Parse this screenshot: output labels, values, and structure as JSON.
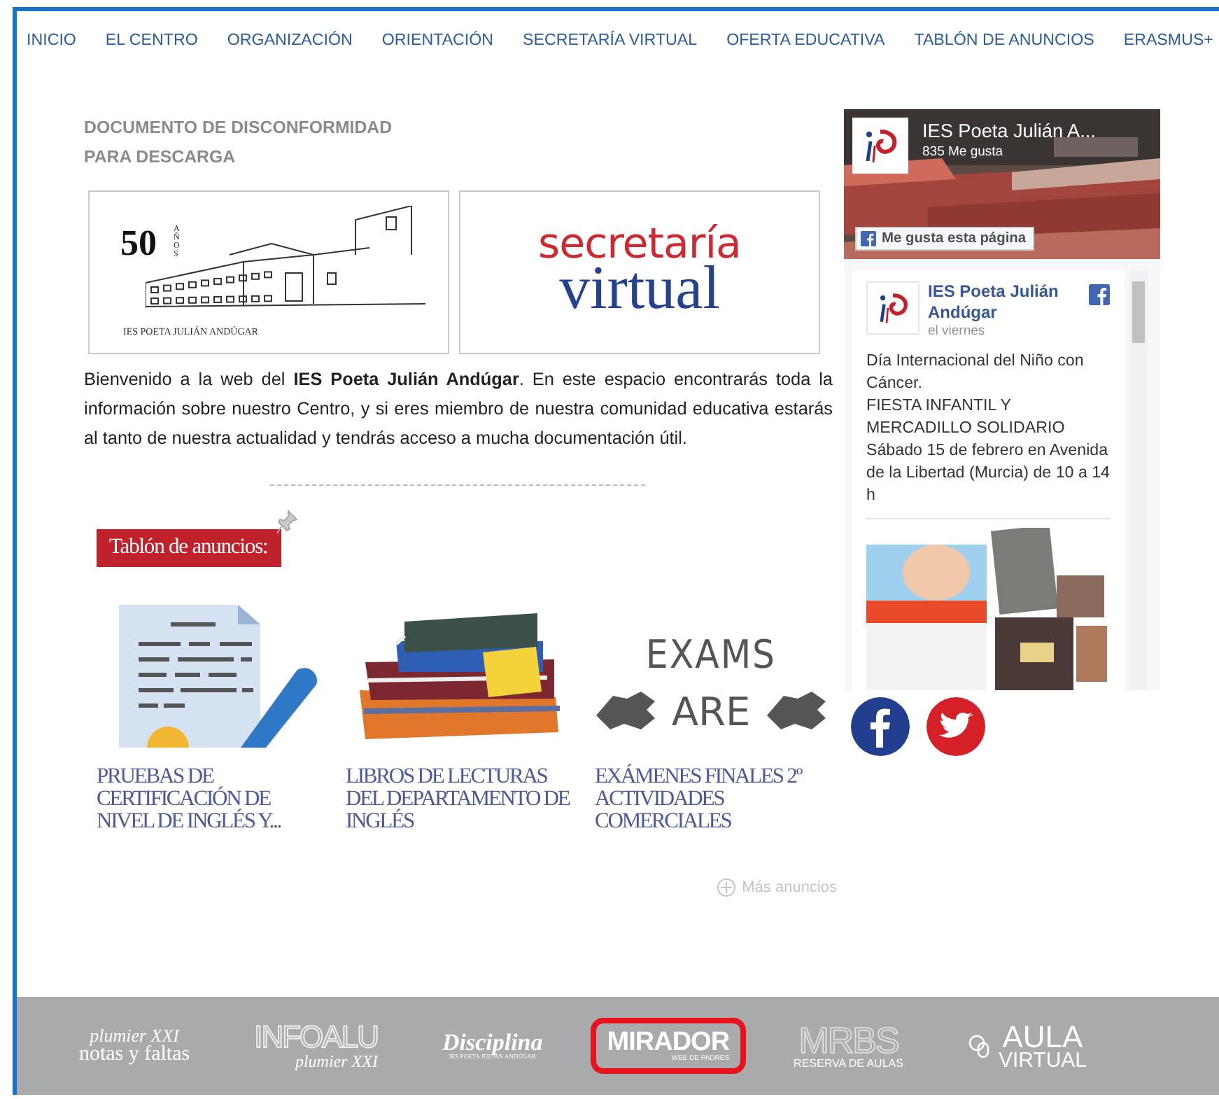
{
  "nav": [
    "INICIO",
    "EL CENTRO",
    "ORGANIZACIÓN",
    "ORIENTACIÓN",
    "SECRETARÍA VIRTUAL",
    "OFERTA EDUCATIVA",
    "TABLÓN DE ANUNCIOS",
    "ERASMUS+"
  ],
  "download_link": "DOCUMENTO DE DISCONFORMIDAD PARA DESCARGA",
  "banners": [
    {
      "kind": "anniversary",
      "number": "50",
      "suffix": "AÑOS",
      "caption": "IES POETA JULIÁN ANDÚGAR"
    },
    {
      "kind": "secretaria",
      "line1": "secretaría",
      "line2": "virtual"
    }
  ],
  "welcome": "Bienvenido a la web del **IES Poeta Julián Andúgar**. En este espacio encontrarás toda la información sobre nuestro Centro, y si eres miembro de nuestra comunidad educativa estarás al tanto de nuestra actualidad y tendrás acceso a mucha documentación útil.",
  "board": {
    "title": "Tablón de anuncios:",
    "cards": [
      {
        "kind": "document",
        "title": "PRUEBAS DE CERTIFICACIÓN DE NIVEL DE INGLÉS Y..."
      },
      {
        "kind": "books",
        "title": "LIBROS DE LECTURAS DEL DEPARTAMENTO DE INGLÉS"
      },
      {
        "kind": "exams",
        "image_text": [
          "EXAMS",
          "ARE"
        ],
        "title": "EXÁMENES FINALES 2º ACTIVIDADES COMERCIALES"
      }
    ],
    "more": "Más anuncios"
  },
  "facebook": {
    "page_name": "IES Poeta Julián A...",
    "likes": "835 Me gusta",
    "like_button": "Me gusta esta página",
    "post": {
      "author": "IES Poeta Julián Andúgar",
      "time": "el viernes",
      "paragraphs": [
        "Día Internacional del Niño con Cáncer.",
        "FIESTA INFANTIL Y MERCADILLO SOLIDARIO",
        "Sábado 15 de febrero en Avenida de la Libertad (Murcia) de 10 a 14 h"
      ]
    }
  },
  "social": [
    {
      "kind": "facebook"
    },
    {
      "kind": "twitter"
    }
  ],
  "footer": [
    {
      "kind": "plumier",
      "top": "plumier XXI",
      "bottom": "notas y faltas",
      "highlighted": false
    },
    {
      "kind": "infoalu",
      "top": "INFOALU",
      "bottom": "plumier XXI",
      "highlighted": false
    },
    {
      "kind": "disciplina",
      "top": "Disciplina",
      "bottom": "IES POETA JULIÁN ANDÚGAR",
      "highlighted": false
    },
    {
      "kind": "mirador",
      "top": "MIRADOR",
      "bottom": "WEB DE PADRES",
      "highlighted": true
    },
    {
      "kind": "mrbs",
      "top": "MRBS",
      "bottom": "RESERVA DE AULAS",
      "highlighted": false
    },
    {
      "kind": "aula",
      "top": "AULA",
      "bottom": "VIRTUAL",
      "highlighted": false
    }
  ]
}
